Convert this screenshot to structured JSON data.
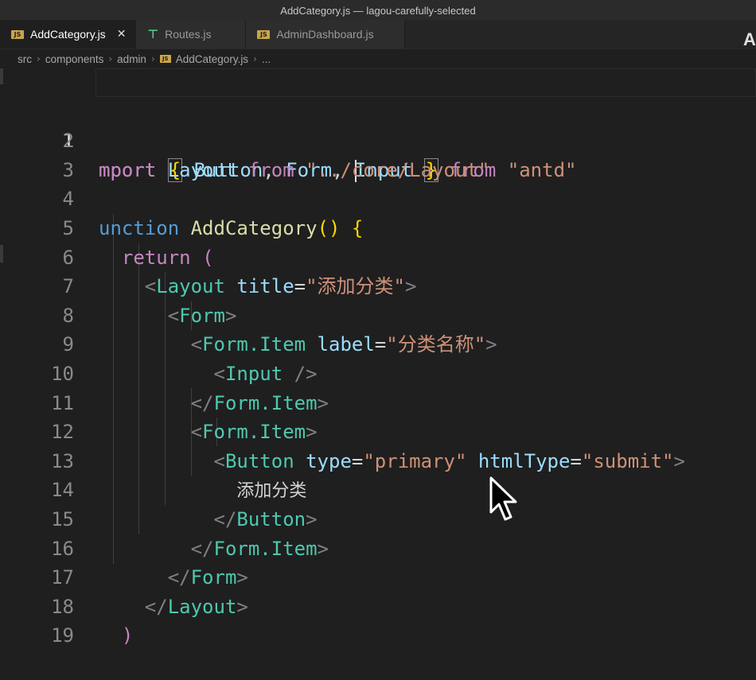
{
  "window": {
    "title": "AddCategory.js — lagou-carefully-selected"
  },
  "tabs": [
    {
      "label": "AddCategory.js",
      "icon": "js-file-icon",
      "active": true
    },
    {
      "label": "Routes.js",
      "icon": "routes-icon",
      "active": false
    },
    {
      "label": "AdminDashboard.js",
      "icon": "js-file-icon",
      "active": false
    }
  ],
  "actions": {
    "partial_label": "A"
  },
  "breadcrumb": [
    "src",
    "components",
    "admin",
    "AddCategory.js",
    "..."
  ],
  "editor": {
    "current_line": 1,
    "line_numbers": [
      "1",
      "2",
      "3",
      "4",
      "5",
      "6",
      "7",
      "8",
      "9",
      "10",
      "11",
      "12",
      "13",
      "14",
      "15",
      "16",
      "17",
      "18",
      "19"
    ],
    "text": {
      "mport": "mport",
      "from": "from",
      "antd": "\"antd\"",
      "button": "Button",
      "form": "Form",
      "input": "Input",
      "layout": "Layout",
      "core_layout": "\"../core/Layout\"",
      "unction": "unction",
      "add_category": "AddCategory",
      "return": "return",
      "title_attr": "title",
      "title_val": "\"添加分类\"",
      "form_item": "Form.Item",
      "label_attr": "label",
      "label_val": "\"分类名称\"",
      "type_attr": "type",
      "type_val": "\"primary\"",
      "html_type_attr": "htmlType",
      "html_type_val": "\"submit\"",
      "button_text": "添加分类"
    }
  }
}
